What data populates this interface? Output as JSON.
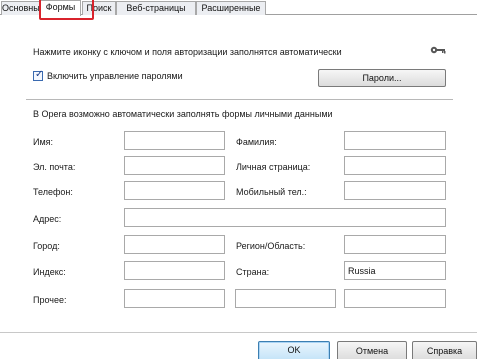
{
  "tabs": [
    {
      "label": "Основные",
      "active": false
    },
    {
      "label": "Формы",
      "active": true
    },
    {
      "label": "Поиск",
      "active": false
    },
    {
      "label": "Веб-страницы",
      "active": false
    },
    {
      "label": "Расширенные",
      "active": false
    }
  ],
  "hint_text": "Нажмите иконку с ключом и поля авторизации заполнятся автоматически",
  "password_manager": {
    "checkbox_label": "Включить управление паролями",
    "checked": true,
    "button_label": "Пароли..."
  },
  "section_title": "В Opera возможно автоматически заполнять формы личными данными",
  "fields": {
    "first_name": {
      "label": "Имя:",
      "value": ""
    },
    "last_name": {
      "label": "Фамилия:",
      "value": ""
    },
    "email": {
      "label": "Эл. почта:",
      "value": ""
    },
    "homepage": {
      "label": "Личная страница:",
      "value": ""
    },
    "phone": {
      "label": "Телефон:",
      "value": ""
    },
    "mobile": {
      "label": "Мобильный тел.:",
      "value": ""
    },
    "address": {
      "label": "Адрес:",
      "value": ""
    },
    "city": {
      "label": "Город:",
      "value": ""
    },
    "region": {
      "label": "Регион/Область:",
      "value": ""
    },
    "zip": {
      "label": "Индекс:",
      "value": ""
    },
    "country": {
      "label": "Страна:",
      "value": "Russia"
    },
    "other": {
      "label": "Прочее:",
      "value": "",
      "value2": "",
      "value3": ""
    }
  },
  "footer": {
    "ok": "OK",
    "cancel": "Отмена",
    "help": "Справка"
  },
  "colors": {
    "highlight": "#d9232c",
    "ok_border": "#3c7fb1"
  }
}
